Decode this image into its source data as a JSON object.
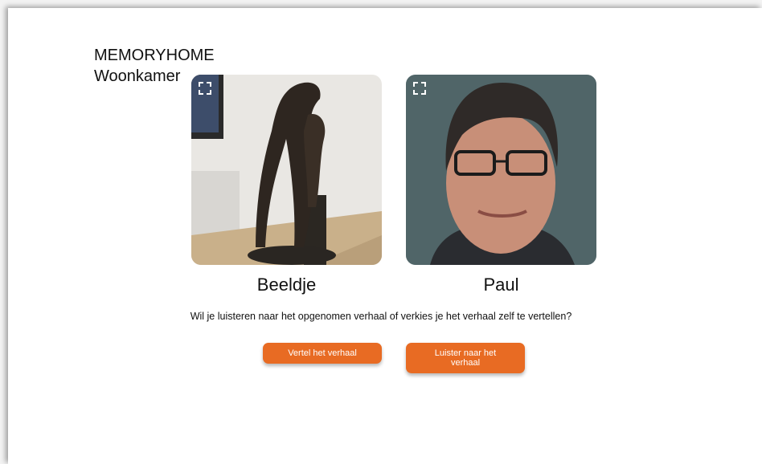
{
  "header": {
    "app_name": "MEMORYHOME",
    "room": "Woonkamer"
  },
  "cards": [
    {
      "title": "Beeldje",
      "image": "statue-photo",
      "expand_icon": "expand-icon"
    },
    {
      "title": "Paul",
      "image": "portrait-photo",
      "expand_icon": "expand-icon"
    }
  ],
  "prompt": {
    "question": "Wil je luisteren naar het opgenomen verhaal of verkies je het verhaal zelf te vertellen?"
  },
  "actions": {
    "tell_label": "Vertel het verhaal",
    "listen_label": "Luister naar het verhaal"
  },
  "colors": {
    "accent": "#e86b23",
    "text": "#111111"
  }
}
